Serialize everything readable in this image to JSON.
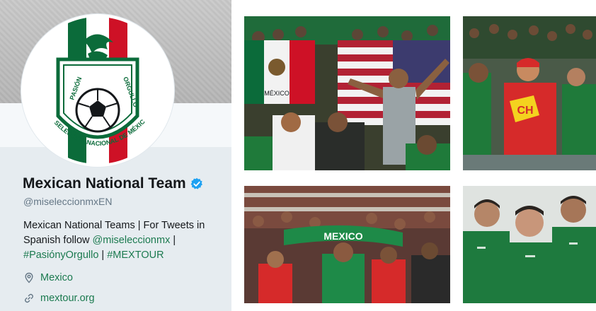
{
  "profile": {
    "name": "Mexican National Team",
    "handle": "@miseleccionmxEN",
    "bio": {
      "part1": "Mexican National Teams | For Tweets in Spanish follow ",
      "mention": "@miseleccionmx",
      "sep1": " | ",
      "hashtag1": "#PasiónyOrgullo",
      "sep2": " | ",
      "hashtag2": "#MEXTOUR"
    },
    "location": "Mexico",
    "website": "mextour.org",
    "logo_text": {
      "left": "PASIÓN",
      "right": "ORGULLO",
      "bottom": "SELECCIÓN NACIONAL DE MÉXICO"
    }
  },
  "photos": {
    "p1": {
      "flag_text": "MÉXICO"
    },
    "p2": {
      "shirt_text": "CH"
    },
    "p3": {
      "scarf_text": "MEXICO"
    }
  },
  "colors": {
    "accent_green": "#1b7a4f",
    "verified_blue": "#1da1f2",
    "flag_green": "#0b6b3a",
    "flag_red": "#ce1126"
  },
  "icons": [
    "verified-badge-icon",
    "location-pin-icon",
    "link-icon"
  ]
}
